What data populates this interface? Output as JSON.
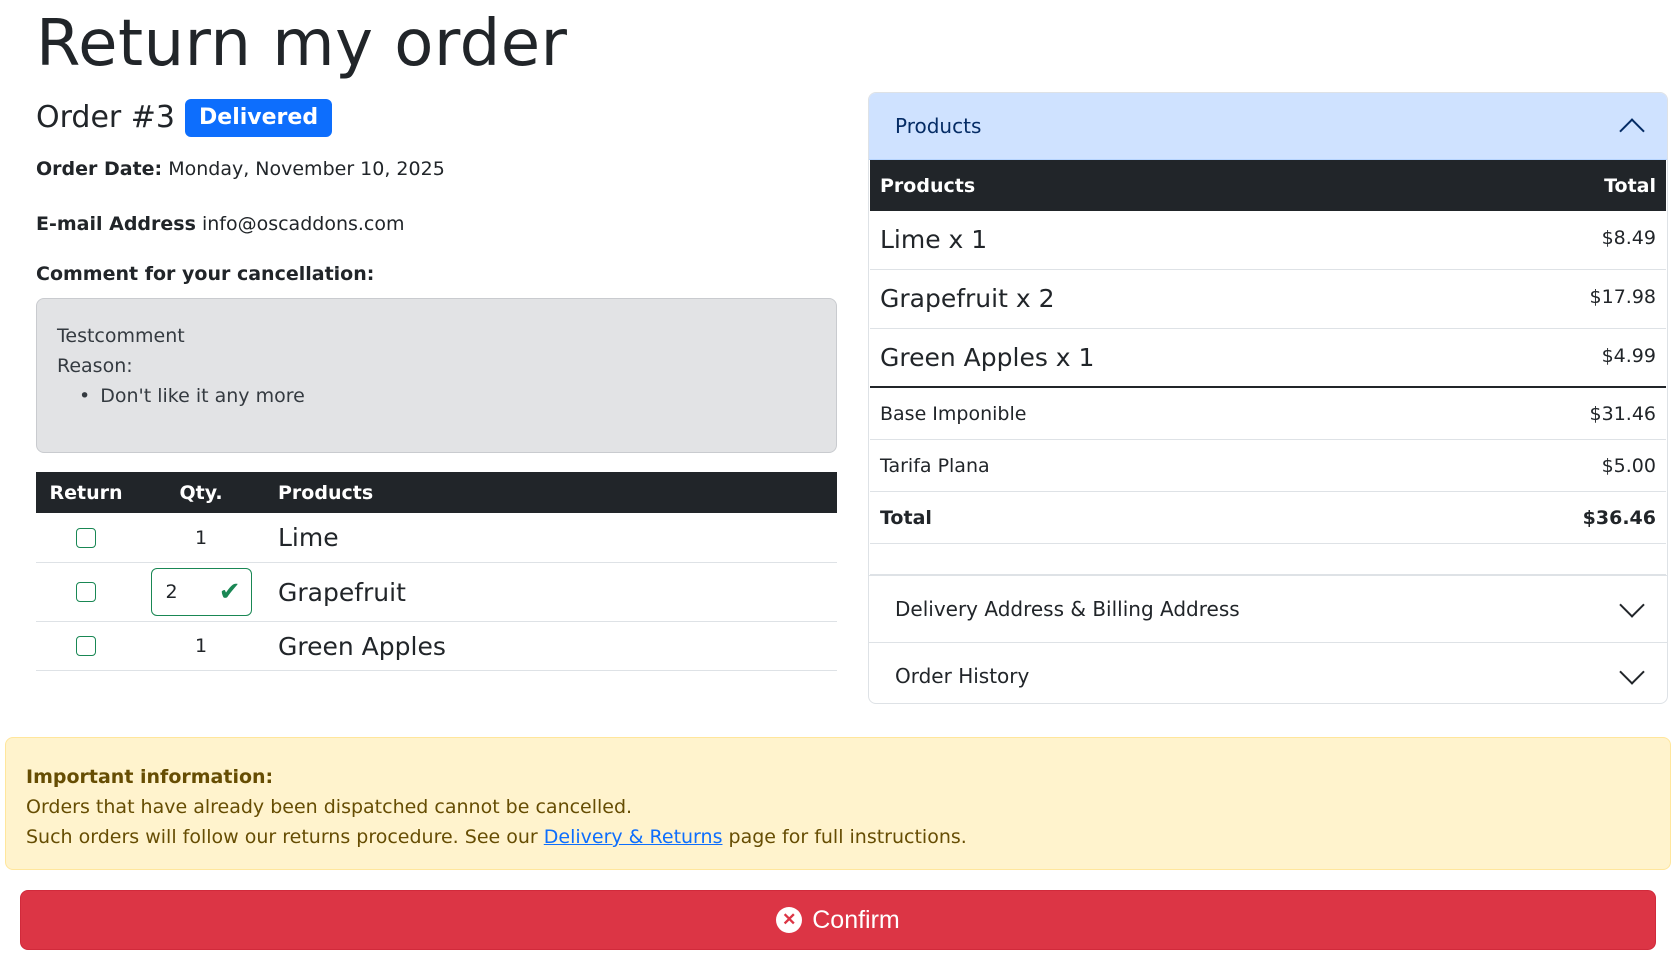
{
  "page": {
    "title": "Return my order"
  },
  "order": {
    "number": "Order #3",
    "status": "Delivered",
    "date_label": "Order Date:",
    "date_value": "Monday, November 10, 2025",
    "email_label": "E-mail Address",
    "email_value": "info@oscaddons.com"
  },
  "comment": {
    "label": "Comment for your cancellation:",
    "text": "Testcomment",
    "reason_label": "Reason:",
    "reasons": [
      "Don't like it any more"
    ]
  },
  "return_table": {
    "headers": {
      "return": "Return",
      "qty": "Qty.",
      "products": "Products"
    },
    "rows": [
      {
        "qty": "1",
        "product": "Lime"
      },
      {
        "qty": "2",
        "product": "Grapefruit"
      },
      {
        "qty": "1",
        "product": "Green Apples"
      }
    ]
  },
  "accordion": {
    "products_title": "Products",
    "delivery_title": "Delivery Address & Billing Address",
    "history_title": "Order History"
  },
  "products_table": {
    "headers": {
      "products": "Products",
      "total": "Total"
    },
    "items": [
      {
        "name": "Lime x 1",
        "price": "$8.49"
      },
      {
        "name": "Grapefruit x 2",
        "price": "$17.98"
      },
      {
        "name": "Green Apples x 1",
        "price": "$4.99"
      }
    ],
    "subtotal_label": "Base Imponible",
    "subtotal_value": "$31.46",
    "shipping_label": "Tarifa Plana",
    "shipping_value": "$5.00",
    "total_label": "Total",
    "total_value": "$36.46"
  },
  "alert": {
    "title": "Important information:",
    "line1": "Orders that have already been dispatched cannot be cancelled.",
    "line2_prefix": "Such orders will follow our returns procedure. See our",
    "link_text": "Delivery & Returns",
    "line2_suffix": "page for full instructions."
  },
  "confirm": {
    "label": "Confirm"
  },
  "colors": {
    "primary": "#0d6efd",
    "danger": "#dc3545",
    "success": "#198754",
    "warning_bg": "#fff3cd",
    "accordion_active": "#cfe2ff",
    "dark": "#212529"
  }
}
